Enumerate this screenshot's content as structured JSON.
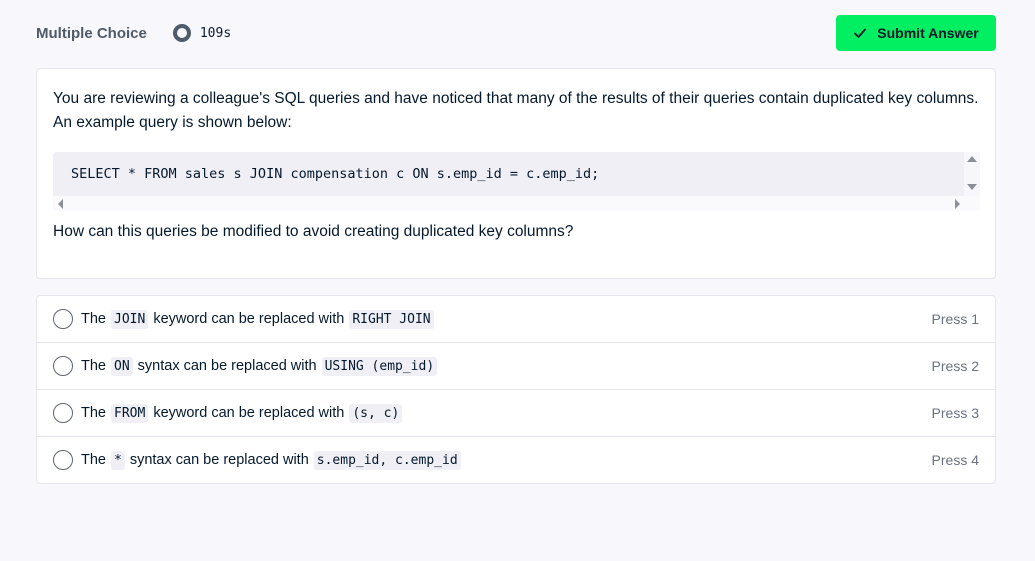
{
  "header": {
    "type_label": "Multiple Choice",
    "timer": "109s",
    "submit_label": "Submit Answer"
  },
  "question": {
    "text": "You are reviewing a colleague's SQL queries and have noticed that many of the results of their queries contain duplicated key columns. An example query is shown below:",
    "code": "SELECT * FROM sales s JOIN compensation c ON s.emp_id = c.emp_id;",
    "prompt": "How can this queries be modified to avoid creating duplicated key columns?"
  },
  "options": [
    {
      "pre": "The",
      "code1": "JOIN",
      "mid": "keyword can be replaced with",
      "code2": "RIGHT JOIN",
      "press": "Press 1"
    },
    {
      "pre": "The",
      "code1": "ON",
      "mid": "syntax can be replaced with",
      "code2": "USING (emp_id)",
      "press": "Press 2"
    },
    {
      "pre": "The",
      "code1": "FROM",
      "mid": "keyword can be replaced with",
      "code2": "(s, c)",
      "press": "Press 3"
    },
    {
      "pre": "The",
      "code1": "*",
      "mid": "syntax can be replaced with",
      "code2": "s.emp_id, c.emp_id",
      "press": "Press 4"
    }
  ],
  "colors": {
    "accent": "#03ef62",
    "background": "#f7f7fc",
    "text": "#05192d"
  },
  "icons": {
    "timer": "timer-ring-icon",
    "submit": "check-icon"
  }
}
